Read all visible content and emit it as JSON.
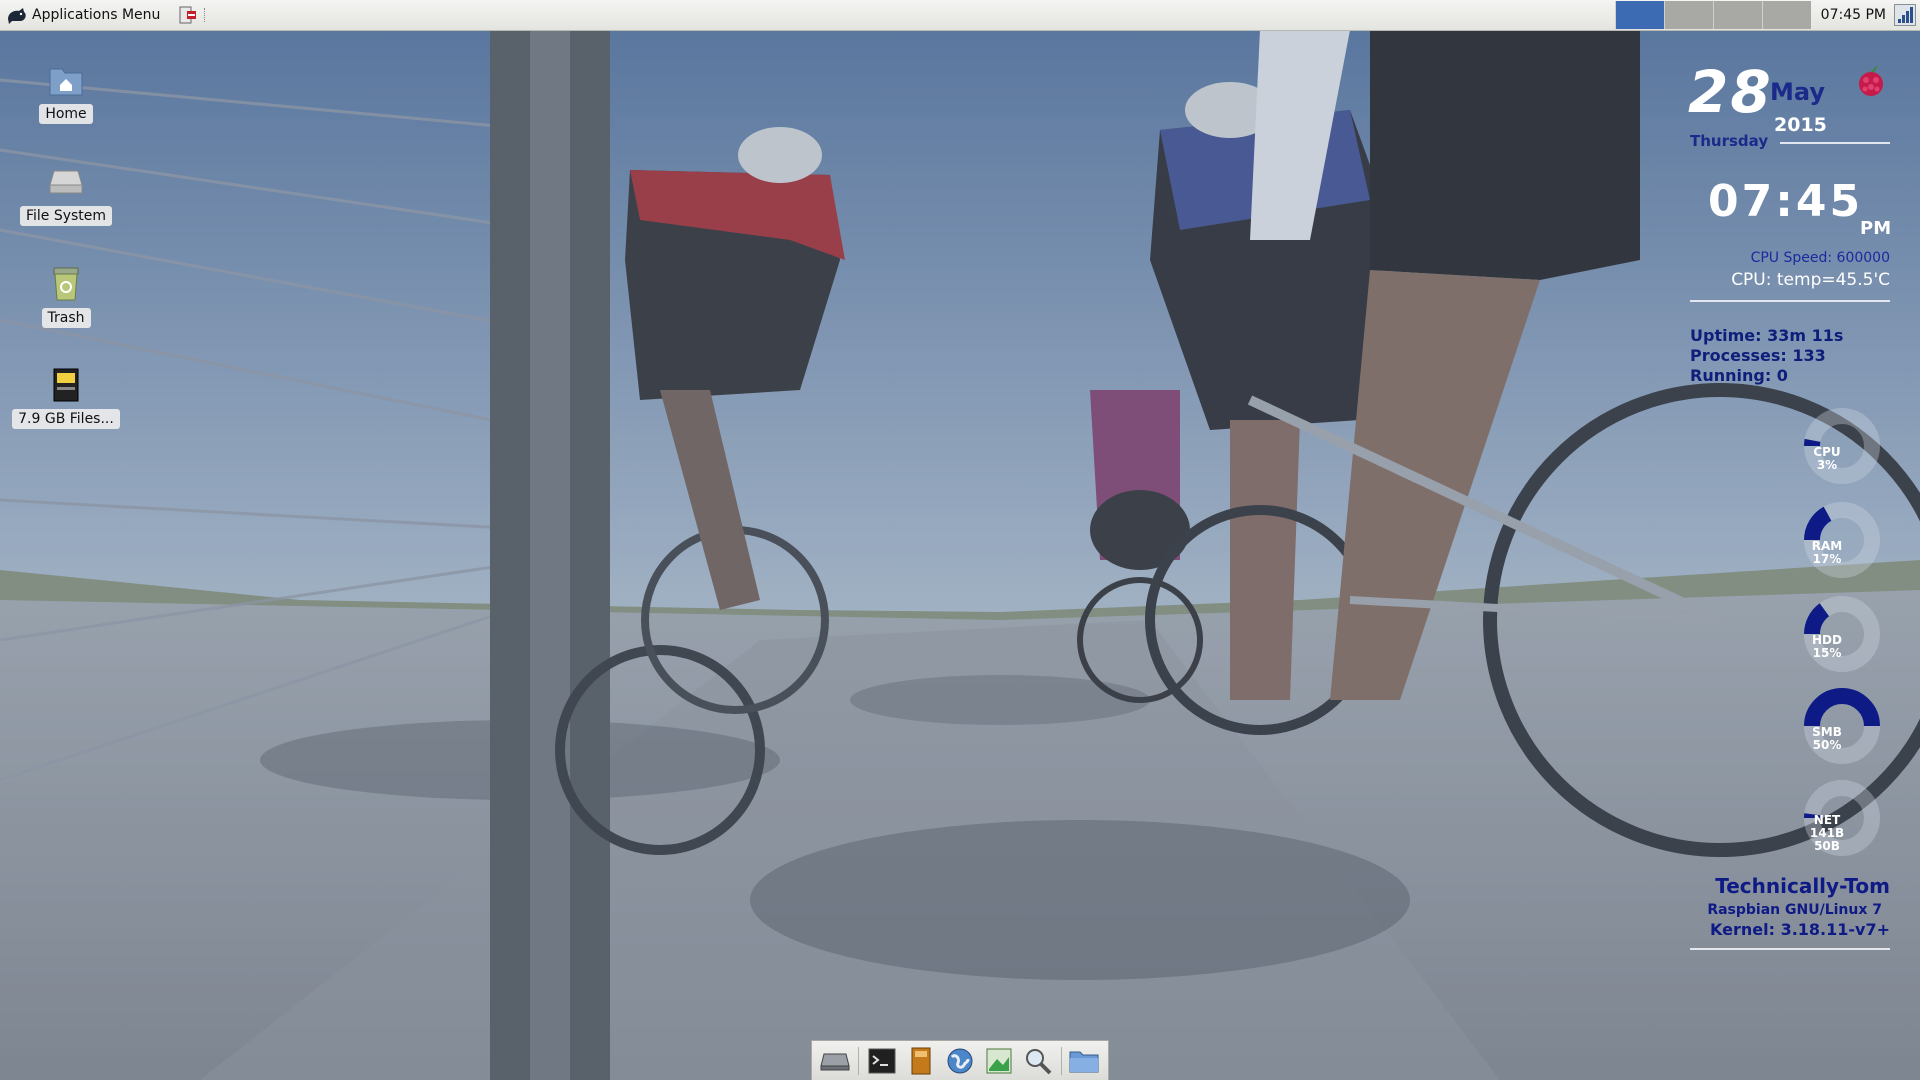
{
  "panel": {
    "apps_menu_label": "Applications Menu",
    "clock": "07:45 PM",
    "workspaces": [
      {
        "icon": "workspace-1",
        "active": true
      },
      {
        "icon": "workspace-2",
        "active": false
      },
      {
        "icon": "workspace-3",
        "active": false
      },
      {
        "icon": "workspace-4",
        "active": false
      }
    ]
  },
  "desktop": {
    "icons": [
      {
        "label": "Home",
        "icon": "home-folder-icon"
      },
      {
        "label": "File System",
        "icon": "drive-icon"
      },
      {
        "label": "Trash",
        "icon": "trash-icon"
      },
      {
        "label": "7.9 GB Files...",
        "icon": "usb-drive-icon"
      }
    ]
  },
  "conky": {
    "day": "28",
    "month": "May",
    "year": "2015",
    "weekday": "Thursday",
    "time": "07:45",
    "ampm": "PM",
    "cpu_speed": "CPU Speed: 600000",
    "cpu_temp": "CPU: temp=45.5'C",
    "uptime": "Uptime: 33m 11s",
    "processes": "Processes: 133",
    "running": "Running: 0",
    "gauges": [
      {
        "name": "CPU",
        "value": "3%",
        "fraction": 0.03
      },
      {
        "name": "RAM",
        "value": "17%",
        "fraction": 0.17
      },
      {
        "name": "HDD",
        "value": "15%",
        "fraction": 0.15
      },
      {
        "name": "SMB",
        "value": "50%",
        "fraction": 0.5
      },
      {
        "name": "NET",
        "value": "141B",
        "value2": "50B",
        "fraction": 0.0
      }
    ],
    "hostname": "Technically-Tom",
    "os": "Raspbian GNU/Linux 7",
    "kernel": "Kernel: 3.18.11-v7+"
  },
  "dock": {
    "items": [
      {
        "icon": "show-desktop-icon"
      },
      {
        "icon": "terminal-icon"
      },
      {
        "icon": "file-manager-book-icon"
      },
      {
        "icon": "web-browser-globe-icon"
      },
      {
        "icon": "image-viewer-icon"
      },
      {
        "icon": "search-icon"
      },
      {
        "icon": "folder-icon"
      }
    ]
  },
  "colors": {
    "conky_accent": "#0e1a86",
    "workspace_active": "#3d6bb3",
    "raspberry": "#c51a4a"
  }
}
